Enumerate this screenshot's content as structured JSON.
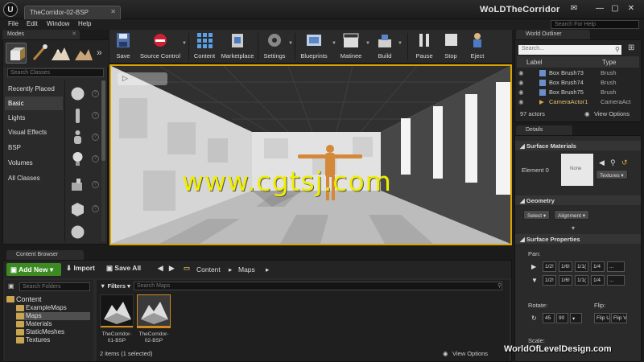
{
  "window": {
    "doc_tab": "TheCorridor-02-BSP",
    "project_name": "WoLDTheCorridor",
    "search_help_placeholder": "Search For Help"
  },
  "menu": [
    "File",
    "Edit",
    "Window",
    "Help"
  ],
  "modes": {
    "tab_label": "Modes",
    "search_placeholder": "Search Classes",
    "categories": [
      "Recently Placed",
      "Basic",
      "Lights",
      "Visual Effects",
      "BSP",
      "Volumes",
      "All Classes"
    ],
    "active_category": "Basic"
  },
  "toolbar": {
    "buttons": [
      "Save",
      "Source Control",
      "Content",
      "Marketplace",
      "Settings",
      "Blueprints",
      "Matinee",
      "Build",
      "Pause",
      "Stop",
      "Eject"
    ]
  },
  "viewport": {
    "watermark": "www.cgtsj.com"
  },
  "world_outliner": {
    "tab_label": "World Outliner",
    "search_placeholder": "Search...",
    "col_label": "Label",
    "col_type": "Type",
    "rows": [
      {
        "label": "Box Brush73",
        "type": "Brush"
      },
      {
        "label": "Box Brush74",
        "type": "Brush"
      },
      {
        "label": "Box Brush75",
        "type": "Brush"
      },
      {
        "label": "CameraActor1",
        "type": "CameraAct"
      }
    ],
    "actor_count": "97 actors",
    "view_options": "View Options"
  },
  "details": {
    "tab_label": "Details",
    "surface_materials": "Surface Materials",
    "element_label": "Element 0",
    "material_thumb": "None",
    "textures": "Textures",
    "geometry": "Geometry",
    "select": "Select",
    "alignment": "Alignment",
    "surface_properties": "Surface Properties",
    "pan": "Pan:",
    "pan_row1": [
      "1/2!",
      "1/6!",
      "1/1(",
      "1/4",
      "..."
    ],
    "pan_row2": [
      "1/2!",
      "1/6!",
      "1/1(",
      "1/4",
      "..."
    ],
    "rotate": "Rotate:",
    "rotate_values": [
      "45",
      "90"
    ],
    "flip": "Flip:",
    "flip_values": [
      "Flip U",
      "Flip V"
    ],
    "scale": "Scale:"
  },
  "content_browser": {
    "tab_label": "Content Browser",
    "add_new": "Add New",
    "import": "Import",
    "save_all": "Save All",
    "crumbs": [
      "Content",
      "Maps"
    ],
    "folder_search": "Search Folders",
    "tree": [
      "Content",
      "ExampleMaps",
      "Maps",
      "Materials",
      "StaticMeshes",
      "Textures"
    ],
    "selected_folder": "Maps",
    "filters": "Filters",
    "asset_search": "Search Maps",
    "assets": [
      "TheCorridor-01-BSP",
      "TheCorridor-02-BSP"
    ],
    "status": "2 items (1 selected)",
    "view_options": "View Options"
  },
  "watermark2": "WorldOfLevelDesign.com",
  "colors": {
    "accent": "#d9a400",
    "add_new": "#3b8b22",
    "watermark": "#f0ee00"
  }
}
